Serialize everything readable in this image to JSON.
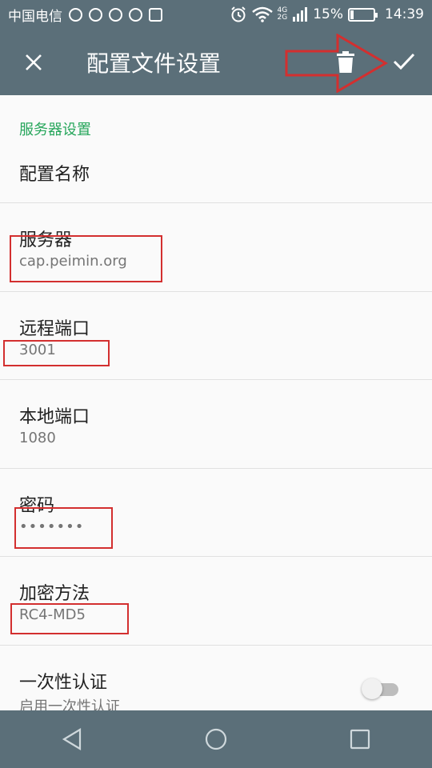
{
  "statusbar": {
    "carrier": "中国电信",
    "battery_percent": "15%",
    "battery_level": 0.15,
    "time": "14:39",
    "network_top": "4G",
    "network_bottom": "2G"
  },
  "appbar": {
    "title": "配置文件设置",
    "close_icon": "close-icon",
    "delete_icon": "trash-icon",
    "save_icon": "check-icon"
  },
  "section": {
    "title": "服务器设置"
  },
  "settings": {
    "profile_name": {
      "label": "配置名称"
    },
    "server": {
      "label": "服务器",
      "value": "cap.peimin.org"
    },
    "remote_port": {
      "label": "远程端口",
      "value": "3001"
    },
    "local_port": {
      "label": "本地端口",
      "value": "1080"
    },
    "password": {
      "label": "密码",
      "value": "•••••••"
    },
    "encryption": {
      "label": "加密方法",
      "value": "RC4-MD5"
    },
    "one_time_auth": {
      "label": "一次性认证",
      "value": "启用一次性认证",
      "enabled": false
    }
  },
  "colors": {
    "bar": "#5b6f79",
    "section_accent": "#26a65b",
    "annotation": "#d32f2f"
  }
}
